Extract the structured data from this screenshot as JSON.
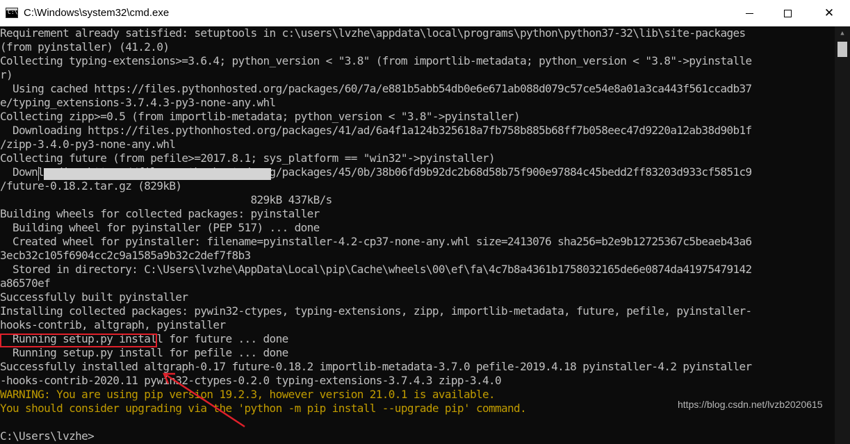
{
  "window": {
    "title": "C:\\Windows\\system32\\cmd.exe",
    "icon_text": "C:\\"
  },
  "controls": {
    "close_glyph": "✕"
  },
  "terminal": {
    "lines": [
      "Requirement already satisfied: setuptools in c:\\users\\lvzhe\\appdata\\local\\programs\\python\\python37-32\\lib\\site-packages",
      "(from pyinstaller) (41.2.0)",
      "Collecting typing-extensions>=3.6.4; python_version < \"3.8\" (from importlib-metadata; python_version < \"3.8\"->pyinstalle",
      "r)",
      "  Using cached https://files.pythonhosted.org/packages/60/7a/e881b5abb54db0e6e671ab088d079c57ce54e8a01a3ca443f561ccadb37",
      "e/typing_extensions-3.7.4.3-py3-none-any.whl",
      "Collecting zipp>=0.5 (from importlib-metadata; python_version < \"3.8\"->pyinstaller)",
      "  Downloading https://files.pythonhosted.org/packages/41/ad/6a4f1a124b325618a7fb758b885b68ff7b058eec47d9220a12ab38d90b1f",
      "/zipp-3.4.0-py3-none-any.whl",
      "Collecting future (from pefile>=2017.8.1; sys_platform == \"win32\"->pyinstaller)",
      "  Downloading https://files.pythonhosted.org/packages/45/0b/38b06fd9b92dc2b68d58b75f900e97884c45bedd2ff83203d933cf5851c9",
      "/future-0.18.2.tar.gz (829kB)",
      "                                        829kB 437kB/s",
      "Building wheels for collected packages: pyinstaller",
      "  Building wheel for pyinstaller (PEP 517) ... done",
      "  Created wheel for pyinstaller: filename=pyinstaller-4.2-cp37-none-any.whl size=2413076 sha256=b2e9b12725367c5beaeb43a6",
      "3ecb32c105f6904cc2c9a1585a9b32c2def7f8b3",
      "  Stored in directory: C:\\Users\\lvzhe\\AppData\\Local\\pip\\Cache\\wheels\\00\\ef\\fa\\4c7b8a4361b1758032165de6e0874da41975479142",
      "a86570ef",
      "Successfully built pyinstaller",
      "Installing collected packages: pywin32-ctypes, typing-extensions, zipp, importlib-metadata, future, pefile, pyinstaller-",
      "hooks-contrib, altgraph, pyinstaller",
      "  Running setup.py install for future ... done",
      "  Running setup.py install for pefile ... done",
      "Successfully installed altgraph-0.17 future-0.18.2 importlib-metadata-3.7.0 pefile-2019.4.18 pyinstaller-4.2 pyinstaller",
      "-hooks-contrib-2020.11 pywin32-ctypes-0.2.0 typing-extensions-3.7.4.3 zipp-3.4.0",
      "WARNING: You are using pip version 19.2.3, however version 21.0.1 is available.",
      "You should consider upgrading via the 'python -m pip install --upgrade pip' command.",
      "",
      "C:\\Users\\lvzhe>"
    ],
    "warning_lines": [
      26,
      27
    ],
    "download_progress": 1.0
  },
  "colors": {
    "terminal_bg": "#0c0c0c",
    "terminal_text": "#c0c0c0",
    "warning_text": "#c19c00",
    "annotation": "#e0202a"
  },
  "watermark": "https://blog.csdn.net/lvzb2020615"
}
